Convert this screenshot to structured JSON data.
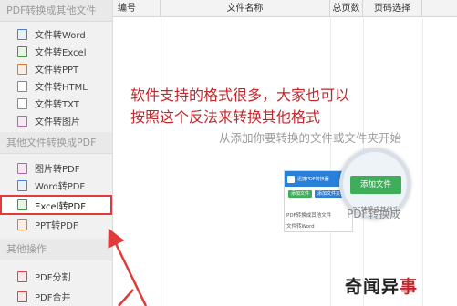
{
  "sidebar": {
    "sections": [
      {
        "title": "PDF转换成其他文件",
        "items": [
          {
            "label": "文件转Word",
            "icon": "word-file-icon",
            "kind": "word"
          },
          {
            "label": "文件转Excel",
            "icon": "excel-file-icon",
            "kind": "excel"
          },
          {
            "label": "文件转PPT",
            "icon": "ppt-file-icon",
            "kind": "ppt"
          },
          {
            "label": "文件转HTML",
            "icon": "html-file-icon",
            "kind": "html"
          },
          {
            "label": "文件转TXT",
            "icon": "txt-file-icon",
            "kind": "txt"
          },
          {
            "label": "文件转图片",
            "icon": "image-file-icon",
            "kind": "img"
          }
        ]
      },
      {
        "title": "其他文件转换成PDF",
        "items": [
          {
            "label": "图片转PDF",
            "icon": "image-file-icon",
            "kind": "img"
          },
          {
            "label": "Word转PDF",
            "icon": "word-file-icon",
            "kind": "word"
          },
          {
            "label": "Excel转PDF",
            "icon": "excel-file-icon",
            "kind": "excel",
            "selected": true
          },
          {
            "label": "PPT转PDF",
            "icon": "ppt-file-icon",
            "kind": "ppt"
          }
        ]
      },
      {
        "title": "其他操作",
        "items": [
          {
            "label": "PDF分割",
            "icon": "pdf-file-icon",
            "kind": "pdf"
          },
          {
            "label": "PDF合并",
            "icon": "pdf-file-icon",
            "kind": "pdf"
          }
        ]
      }
    ]
  },
  "table": {
    "headers": [
      "编号",
      "文件名称",
      "总页数",
      "页码选择",
      ""
    ]
  },
  "annotation": {
    "line1": "软件支持的格式很多，大家也可以",
    "line2": "按照这个反法来转换其他格式",
    "color": "#c0272d"
  },
  "hint": "从添加你要转换的文件或文件夹开始",
  "preview": {
    "title": "迅捷PDF转换器",
    "btn_add": "添加文件",
    "btn_folder": "添加文件夹",
    "caption": "PDF转换成其他文件",
    "row": "文件转Word"
  },
  "magnifier": {
    "button": "添加文件",
    "caption": "PDF转换成其他文件",
    "after_text": "PDF转换成"
  },
  "watermark": {
    "text": "奇闻异",
    "last_char": "事"
  },
  "colors": {
    "highlight": "#e03a3a",
    "accent_blue": "#2a7fd6",
    "accent_green": "#3fae5a"
  }
}
